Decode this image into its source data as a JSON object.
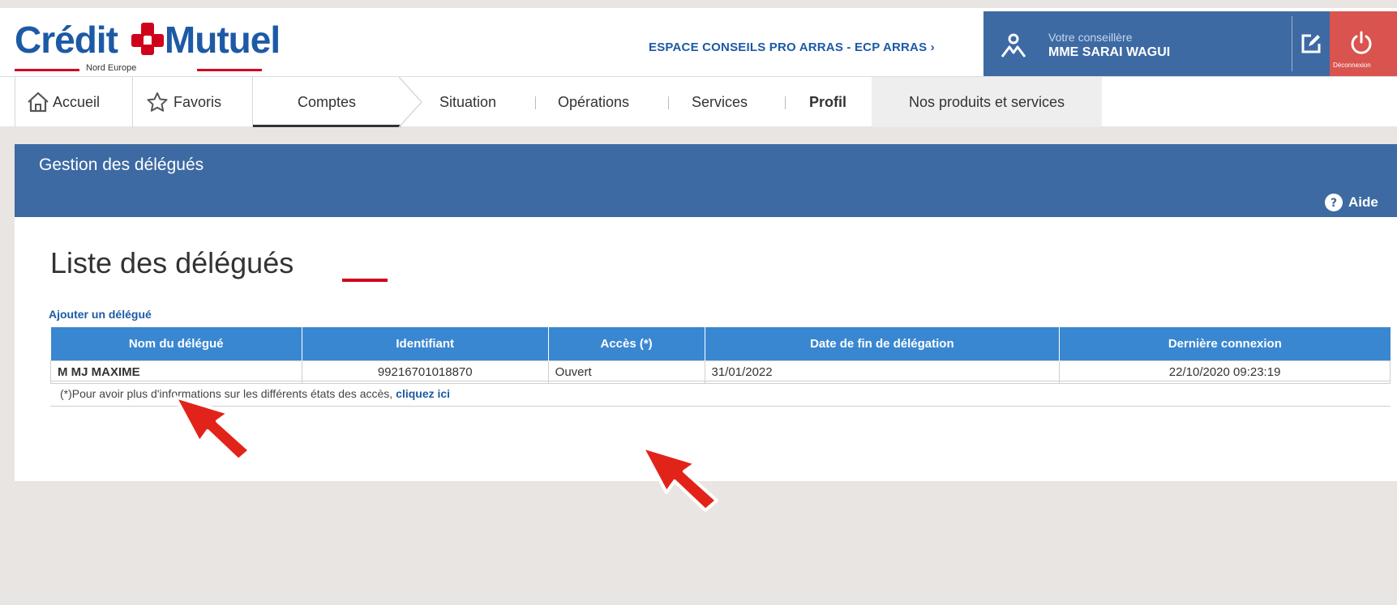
{
  "header": {
    "logo": {
      "text_left": "Crédit",
      "text_right": "Mutuel",
      "sub": "Nord Europe"
    },
    "espace_label": "ESPACE CONSEILS PRO ARRAS - ECP ARRAS ›",
    "advisor": {
      "role": "Votre conseillère",
      "name": "MME SARAI WAGUI"
    },
    "logout_label": "Déconnexion"
  },
  "nav": {
    "accueil": "Accueil",
    "favoris": "Favoris",
    "comptes": "Comptes",
    "situation": "Situation",
    "operations": "Opérations",
    "services": "Services",
    "profil": "Profil",
    "produits": "Nos produits et services"
  },
  "panel": {
    "title": "Gestion des délégués",
    "help_label": "Aide",
    "page_title": "Liste des délégués",
    "add_link": "Ajouter un délégué"
  },
  "table": {
    "headers": [
      "Nom du délégué",
      "Identifiant",
      "Accès (*)",
      "Date de fin de délégation",
      "Dernière connexion"
    ],
    "rows": [
      {
        "name": "M MJ MAXIME",
        "id": "99216701018870",
        "access": "Ouvert",
        "end_date": "31/01/2022",
        "last_login": "22/10/2020 09:23:19"
      }
    ]
  },
  "note": {
    "text": "(*)Pour avoir plus d'informations sur les différents états des accès,",
    "link": "cliquez ici"
  },
  "colors": {
    "brand_blue": "#1d5aa6",
    "panel_blue": "#3d6aa3",
    "table_header": "#3a87d1",
    "accent_red": "#d0021b"
  }
}
